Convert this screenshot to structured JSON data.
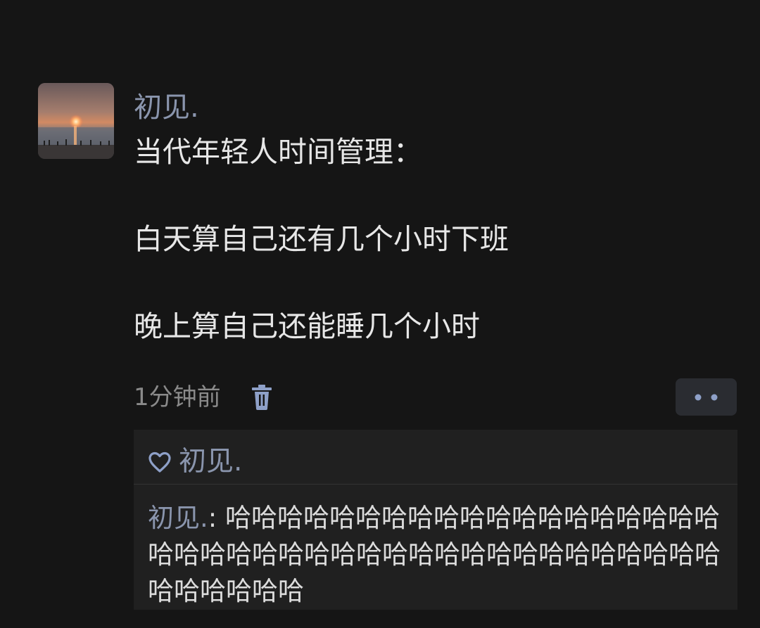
{
  "post": {
    "author": "初见.",
    "content_lines": [
      "当代年轻人时间管理：",
      "白天算自己还有几个小时下班",
      "晚上算自己还能睡几个小时"
    ],
    "timestamp": "1分钟前"
  },
  "likes": {
    "names": "初见."
  },
  "comments": [
    {
      "author": "初见.",
      "separator": ": ",
      "text": "哈哈哈哈哈哈哈哈哈哈哈哈哈哈哈哈哈哈哈哈哈哈哈哈哈哈哈哈哈哈哈哈哈哈哈哈哈哈哈哈哈哈哈哈哈哈哈"
    }
  ],
  "colors": {
    "background": "#151515",
    "name": "#8a95ad",
    "text": "#e7e7e7",
    "muted": "#8a8a8a",
    "panel": "#202020"
  },
  "icons": {
    "avatar": "sunset-avatar",
    "delete": "trash-icon",
    "more": "more-dots-icon",
    "like": "heart-outline-icon"
  }
}
